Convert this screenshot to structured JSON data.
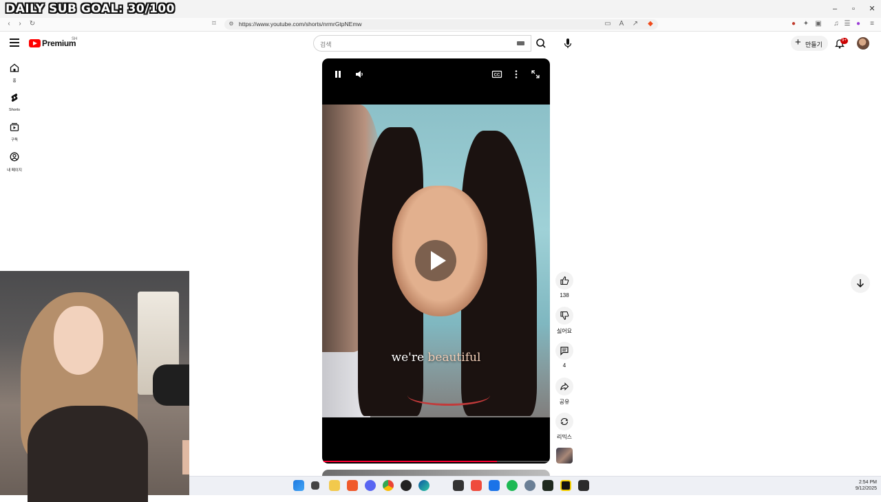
{
  "stream_overlay": {
    "goal_text": "DAILY SUB GOAL: 30/100"
  },
  "browser": {
    "url": "https://www.youtube.com/shorts/nrmrGtpNEmw",
    "window_controls": {
      "minimize": "–",
      "maximize": "▫",
      "close": "✕"
    }
  },
  "header": {
    "brand": "Premium",
    "country": "SH",
    "search": {
      "placeholder": "검색"
    },
    "create_label": "만들기",
    "notification_badge": "9+"
  },
  "sidebar": {
    "items": [
      {
        "label": "홈",
        "icon": "home-icon"
      },
      {
        "label": "Shorts",
        "icon": "shorts-icon"
      },
      {
        "label": "구독",
        "icon": "subscriptions-icon"
      },
      {
        "label": "내 페이지",
        "icon": "you-icon"
      }
    ]
  },
  "player": {
    "subtitle_plain": "we're",
    "subtitle_highlight": "beautiful",
    "state": "paused",
    "progress": 0.77
  },
  "actions": {
    "like_count": "138",
    "dislike_label": "싫어요",
    "comment_count": "4",
    "share_label": "공유",
    "remix_label": "리믹스"
  },
  "taskbar": {
    "time": "2:54 PM",
    "date": "9/12/2025"
  },
  "colors": {
    "youtube_red": "#ff0000",
    "progress_red": "#ff0033",
    "badge_red": "#cc0000"
  }
}
